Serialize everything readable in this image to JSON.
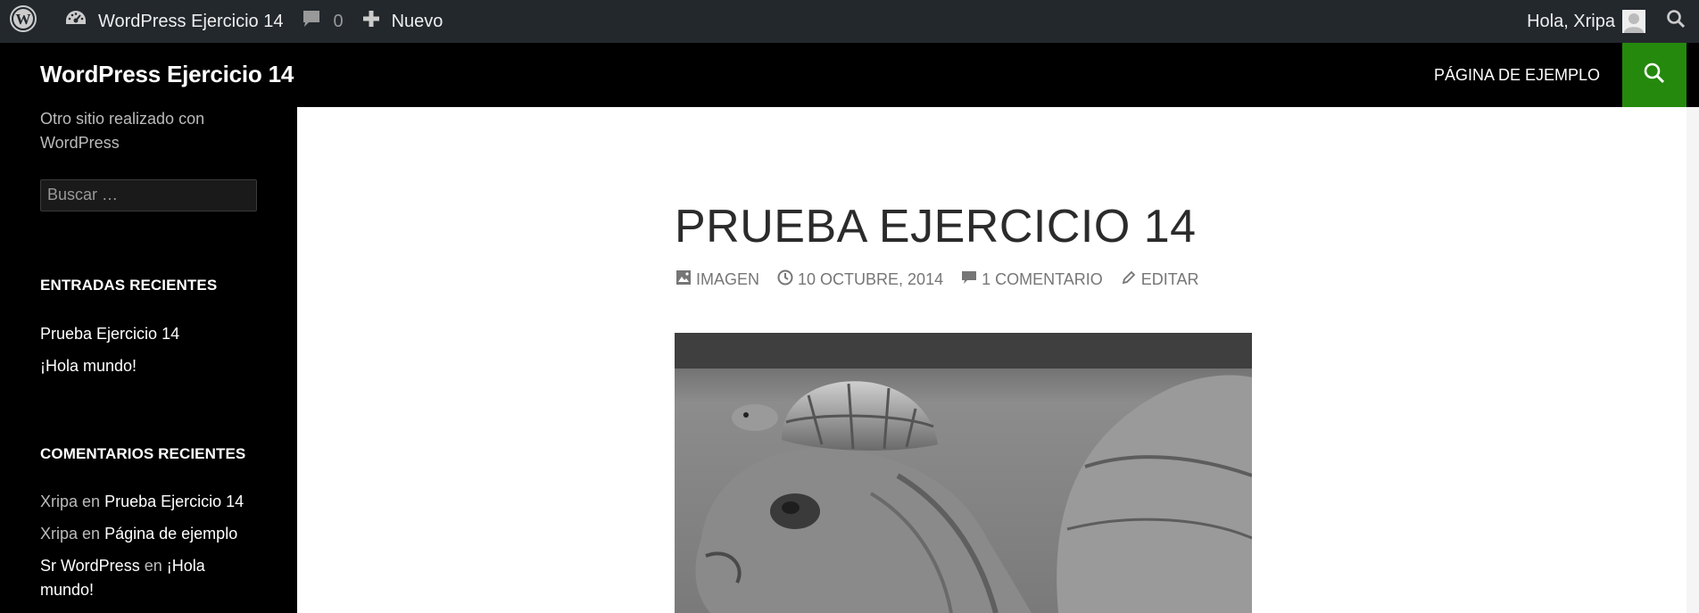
{
  "adminbar": {
    "site_name": "WordPress Ejercicio 14",
    "comments_count": "0",
    "new_label": "Nuevo",
    "greeting": "Hola, Xripa"
  },
  "header": {
    "site_title": "WordPress Ejercicio 14",
    "menu": [
      "PÁGINA DE EJEMPLO"
    ],
    "accent_color": "#24890d"
  },
  "sidebar": {
    "description": "Otro sitio realizado con WordPress",
    "search_placeholder": "Buscar …",
    "recent_posts_title": "ENTRADAS RECIENTES",
    "recent_posts": [
      "Prueba Ejercicio 14",
      "¡Hola mundo!"
    ],
    "recent_comments_title": "COMENTARIOS RECIENTES",
    "recent_comments": [
      {
        "author": "Xripa",
        "sep": "en",
        "post": "Prueba Ejercicio 14"
      },
      {
        "author": "Xripa",
        "sep": "en",
        "post": "Página de ejemplo"
      },
      {
        "author": "Sr WordPress",
        "sep": "en",
        "post": "¡Hola mundo!"
      }
    ]
  },
  "post": {
    "title": "PRUEBA EJERCICIO 14",
    "format": "IMAGEN",
    "date": "10 OCTUBRE, 2014",
    "comments": "1 COMENTARIO",
    "edit": "EDITAR",
    "image_alt": "turtle"
  }
}
